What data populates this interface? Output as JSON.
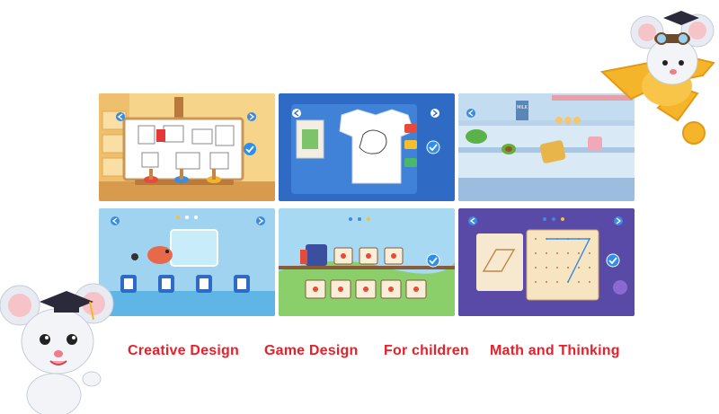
{
  "captions": [
    "Creative Design",
    "Game Design",
    "For children",
    "Math and Thinking"
  ],
  "tiles": [
    {
      "scene": "painting-easel"
    },
    {
      "scene": "t-shirt-coloring"
    },
    {
      "scene": "kitchen-food",
      "shelf_label": "MILK"
    },
    {
      "scene": "underwater-shapes"
    },
    {
      "scene": "number-train"
    },
    {
      "scene": "geoboard-math"
    }
  ],
  "colors": {
    "caption": "#e8202a",
    "check": "#2f8ee8"
  }
}
